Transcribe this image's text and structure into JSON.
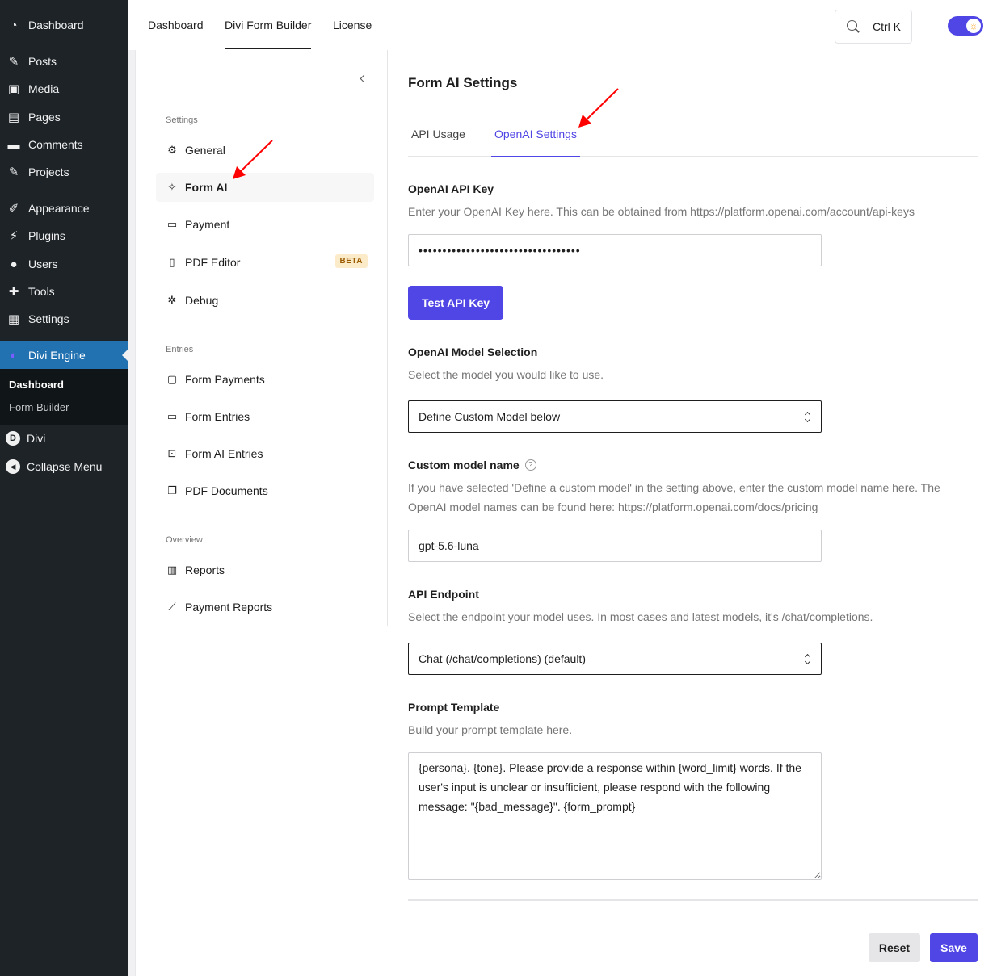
{
  "wp_menu": {
    "items": [
      {
        "label": "Dashboard",
        "icon": "dashboard-icon",
        "glyph": "◔"
      },
      {
        "label": "Posts",
        "icon": "pin-icon",
        "glyph": "✎"
      },
      {
        "label": "Media",
        "icon": "media-icon",
        "glyph": "▣"
      },
      {
        "label": "Pages",
        "icon": "pages-icon",
        "glyph": "▤"
      },
      {
        "label": "Comments",
        "icon": "comment-icon",
        "glyph": "▬"
      },
      {
        "label": "Projects",
        "icon": "pin-icon",
        "glyph": "✎"
      },
      {
        "label": "Appearance",
        "icon": "brush-icon",
        "glyph": "✐"
      },
      {
        "label": "Plugins",
        "icon": "plug-icon",
        "glyph": "⚡"
      },
      {
        "label": "Users",
        "icon": "user-icon",
        "glyph": "●"
      },
      {
        "label": "Tools",
        "icon": "wrench-icon",
        "glyph": "✚"
      },
      {
        "label": "Settings",
        "icon": "sliders-icon",
        "glyph": "▦"
      },
      {
        "label": "Divi Engine",
        "icon": "divi-engine-icon",
        "glyph": "◐"
      },
      {
        "label": "Divi",
        "icon": "divi-icon",
        "glyph": "D"
      },
      {
        "label": "Collapse Menu",
        "icon": "collapse-icon",
        "glyph": "◀"
      }
    ],
    "submenu": {
      "dashboard": "Dashboard",
      "form_builder": "Form Builder"
    }
  },
  "topbar": {
    "tabs": [
      "Dashboard",
      "Divi Form Builder",
      "License"
    ],
    "search_shortcut": "Ctrl K",
    "theme_glyph": "☼"
  },
  "inner_nav": {
    "settings_title": "Settings",
    "general": "General",
    "form_ai": "Form AI",
    "payment": "Payment",
    "pdf_editor": "PDF Editor",
    "beta": "BETA",
    "debug": "Debug",
    "entries_title": "Entries",
    "form_payments": "Form Payments",
    "form_entries": "Form Entries",
    "form_ai_entries": "Form AI Entries",
    "pdf_documents": "PDF Documents",
    "overview_title": "Overview",
    "reports": "Reports",
    "payment_reports": "Payment Reports"
  },
  "content": {
    "title": "Form AI Settings",
    "tabs": {
      "api_usage": "API Usage",
      "openai_settings": "OpenAI Settings"
    },
    "api_key": {
      "label": "OpenAI API Key",
      "desc": "Enter your OpenAI Key here. This can be obtained from https://platform.openai.com/account/api-keys",
      "value": "••••••••••••••••••••••••••••••••••"
    },
    "test_button": "Test API Key",
    "model": {
      "label": "OpenAI Model Selection",
      "desc": "Select the model you would like to use.",
      "selected": "Define Custom Model below"
    },
    "custom_model": {
      "label": "Custom model name",
      "help": "?",
      "desc": "If you have selected 'Define a custom model' in the setting above, enter the custom model name here. The OpenAI model names can be found here: https://platform.openai.com/docs/pricing",
      "value": "gpt-5.6-luna"
    },
    "endpoint": {
      "label": "API Endpoint",
      "desc": "Select the endpoint your model uses. In most cases and latest models, it's /chat/completions.",
      "selected": "Chat (/chat/completions) (default)"
    },
    "prompt": {
      "label": "Prompt Template",
      "desc": "Build your prompt template here.",
      "value": "{persona}. {tone}. Please provide a response within {word_limit} words. If the user's input is unclear or insufficient, please respond with the following message: \"{bad_message}\". {form_prompt}"
    },
    "reset": "Reset",
    "save": "Save"
  },
  "colors": {
    "accent": "#4f46e5",
    "wp_sidebar": "#1d2327",
    "wp_active": "#2271b1",
    "annotation": "#ff0000"
  }
}
